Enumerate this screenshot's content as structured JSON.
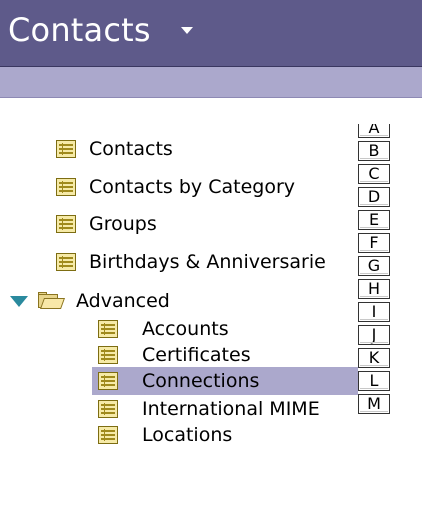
{
  "header": {
    "title": "Contacts"
  },
  "tree": {
    "items": [
      {
        "label": "Contacts",
        "icon": "list-icon"
      },
      {
        "label": "Contacts by Category",
        "icon": "list-icon"
      },
      {
        "label": "Groups",
        "icon": "list-icon"
      },
      {
        "label": "Birthdays & Anniversarie",
        "icon": "list-icon"
      },
      {
        "label": "Advanced",
        "icon": "folder-open-icon",
        "expanded": true
      },
      {
        "label": "Accounts",
        "icon": "list-icon"
      },
      {
        "label": "Certificates",
        "icon": "list-icon"
      },
      {
        "label": "Connections",
        "icon": "list-icon",
        "selected": true
      },
      {
        "label": "International MIME",
        "icon": "list-icon"
      },
      {
        "label": "Locations",
        "icon": "list-icon"
      }
    ]
  },
  "alpha_index": [
    "A",
    "B",
    "C",
    "D",
    "E",
    "F",
    "G",
    "H",
    "I",
    "J",
    "K",
    "L",
    "M"
  ],
  "colors": {
    "header": "#5e5a8a",
    "subbar": "#aba8cc",
    "selection": "#aba8cc",
    "expander": "#2a8a9e"
  }
}
